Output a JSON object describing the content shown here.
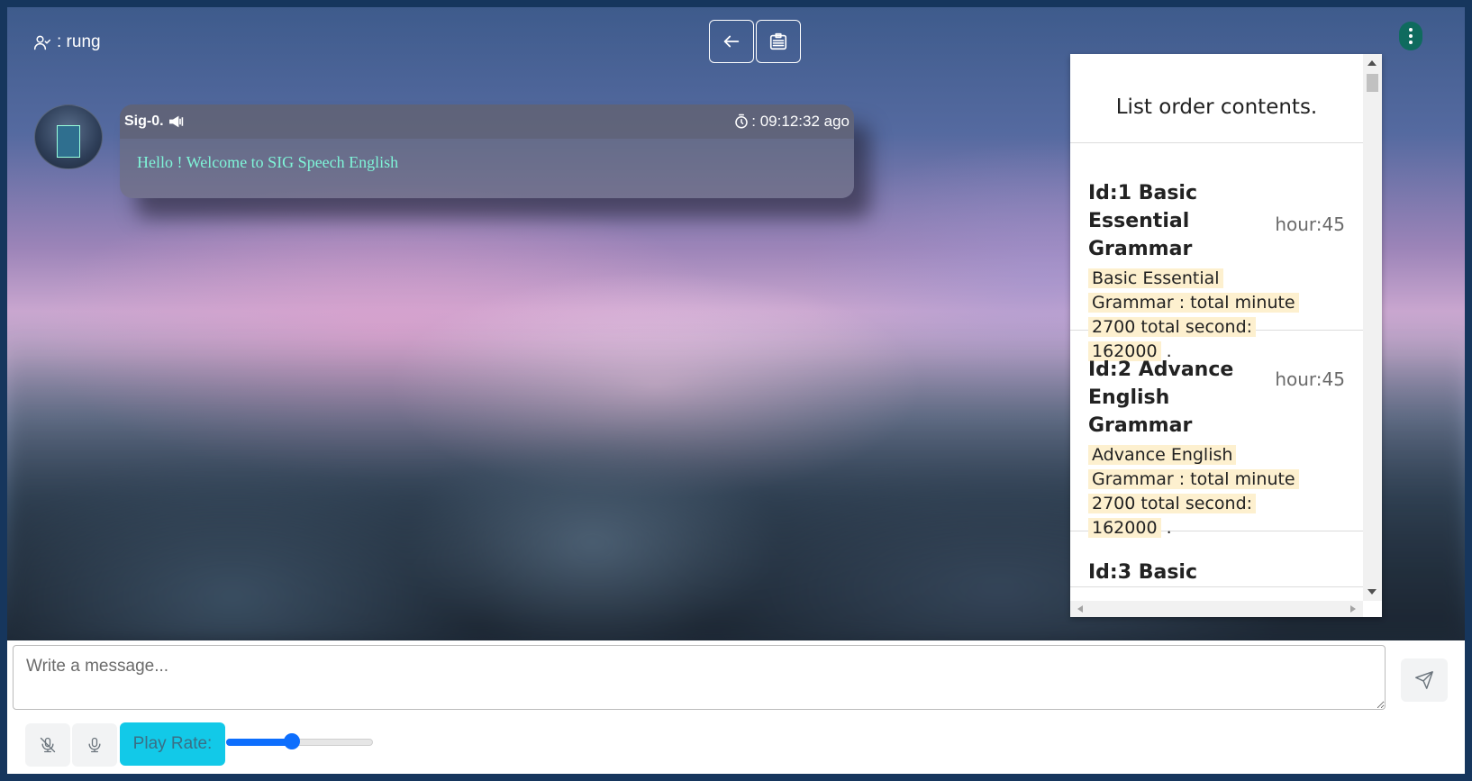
{
  "user": {
    "label": ": rung"
  },
  "message": {
    "sender": "Sig-0.",
    "time": ": 09:12:32 ago",
    "text": "Hello ! Welcome to SIG Speech English"
  },
  "panel": {
    "title": "List order contents.",
    "items": [
      {
        "title": "Id:1 Basic Essential Grammar",
        "hour": "hour:45",
        "desc": "Basic Essential Grammar : total minute 2700 total second: 162000",
        "desc_end": "."
      },
      {
        "title": "Id:2 Advance English Grammar",
        "hour": "hour:45",
        "desc": "Advance English Grammar : total minute 2700 total second: 162000",
        "desc_end": "."
      },
      {
        "title": "Id:3 Basic"
      }
    ]
  },
  "composer": {
    "placeholder": "Write a message...",
    "play_rate_label": "Play Rate:",
    "play_rate_value": 0.45
  },
  "colors": {
    "accent": "#0d6efd",
    "play_rate_bg": "#12c9e8",
    "message_text": "#7ff5d8"
  }
}
